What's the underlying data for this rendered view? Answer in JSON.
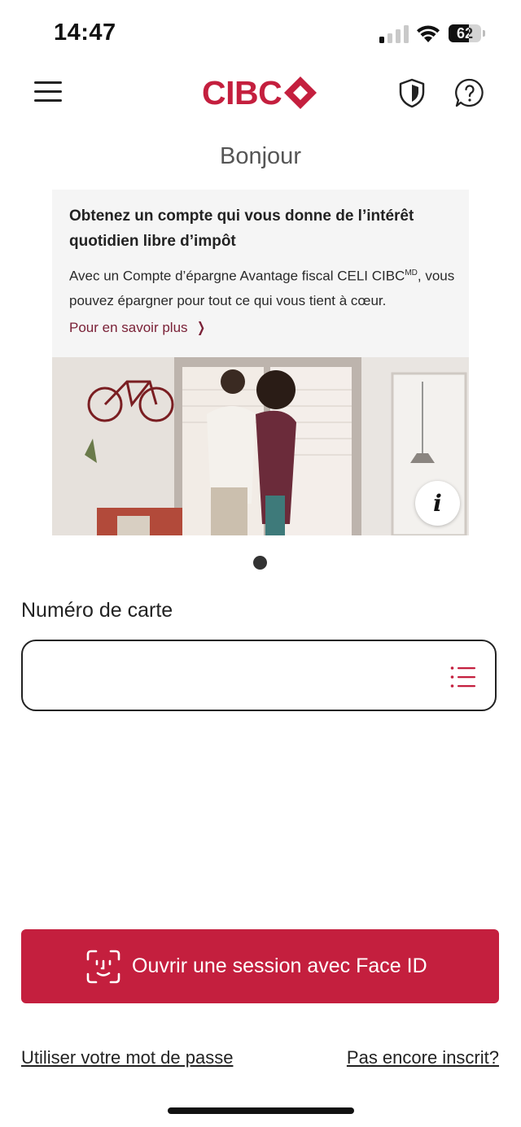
{
  "status_bar": {
    "time": "14:47",
    "battery_percent": "62",
    "battery_level": 0.62
  },
  "header": {
    "brand": "CIBC"
  },
  "greeting": "Bonjour",
  "promo": {
    "title": "Obtenez un compte qui vous donne de l’intérêt quotidien libre d’impôt",
    "body_prefix": "Avec un Compte d’épargne Avantage fiscal CELI CIBC",
    "body_sup": "MD",
    "body_suffix": ", vous pouvez épargner pour tout ce qui vous tient à cœur.",
    "link_label": "Pour en savoir plus",
    "info_glyph": "i"
  },
  "card_number": {
    "label": "Numéro de carte",
    "value": "",
    "placeholder": ""
  },
  "face_id_button": {
    "label": "Ouvrir une session avec Face ID"
  },
  "footer_links": {
    "password": "Utiliser votre mot de passe",
    "register": "Pas encore inscrit?"
  },
  "colors": {
    "brand_red": "#c41f3e",
    "link_maroon": "#7a2137",
    "card_bg": "#f5f5f5"
  },
  "icons": [
    "menu-icon",
    "cibc-logo-mark",
    "shield-icon",
    "help-icon",
    "info-icon",
    "list-icon",
    "face-id-icon",
    "chevron-right-icon"
  ]
}
